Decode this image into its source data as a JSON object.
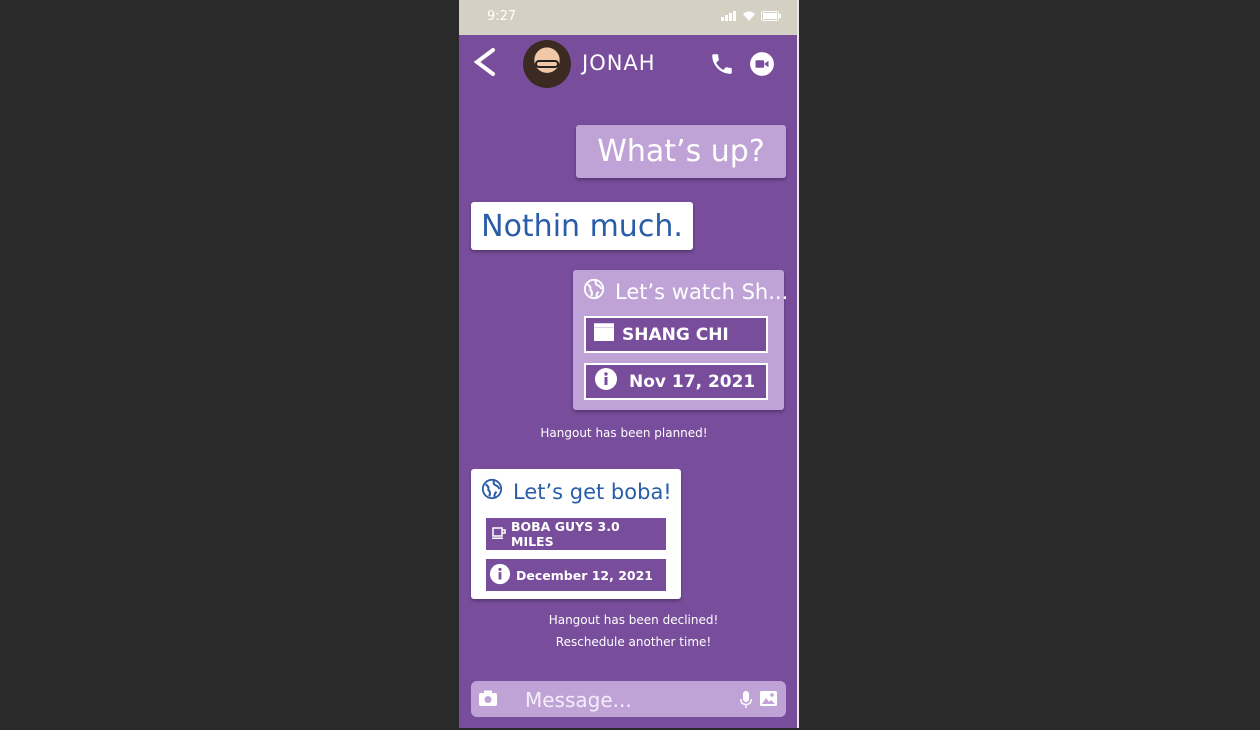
{
  "status_bar": {
    "time": "9:27",
    "icons": [
      "signal-icon",
      "wifi-icon",
      "battery-icon"
    ]
  },
  "header": {
    "contact_name": "JONAH",
    "icons": [
      "back-arrow-icon",
      "phone-icon",
      "video-call-icon"
    ]
  },
  "colors": {
    "background": "#784e9c",
    "outgoing_bubble": "#c0a3d6",
    "incoming_bubble": "#ffffff",
    "incoming_text": "#2a5da8"
  },
  "messages": [
    {
      "direction": "outgoing",
      "text": "What’s up?"
    },
    {
      "direction": "incoming",
      "text": "Nothin much."
    }
  ],
  "hangout_sent": {
    "title": "Let’s watch Sh...",
    "movie": "SHANG CHI",
    "date": "Nov 17, 2021",
    "status": "Hangout has been planned!"
  },
  "hangout_received": {
    "title": "Let’s get boba!",
    "place": "BOBA GUYS 3.0 MILES",
    "date": "December 12, 2021",
    "status_line1": "Hangout has been declined!",
    "status_line2": "Reschedule another time!"
  },
  "composer": {
    "placeholder": "Message..."
  }
}
